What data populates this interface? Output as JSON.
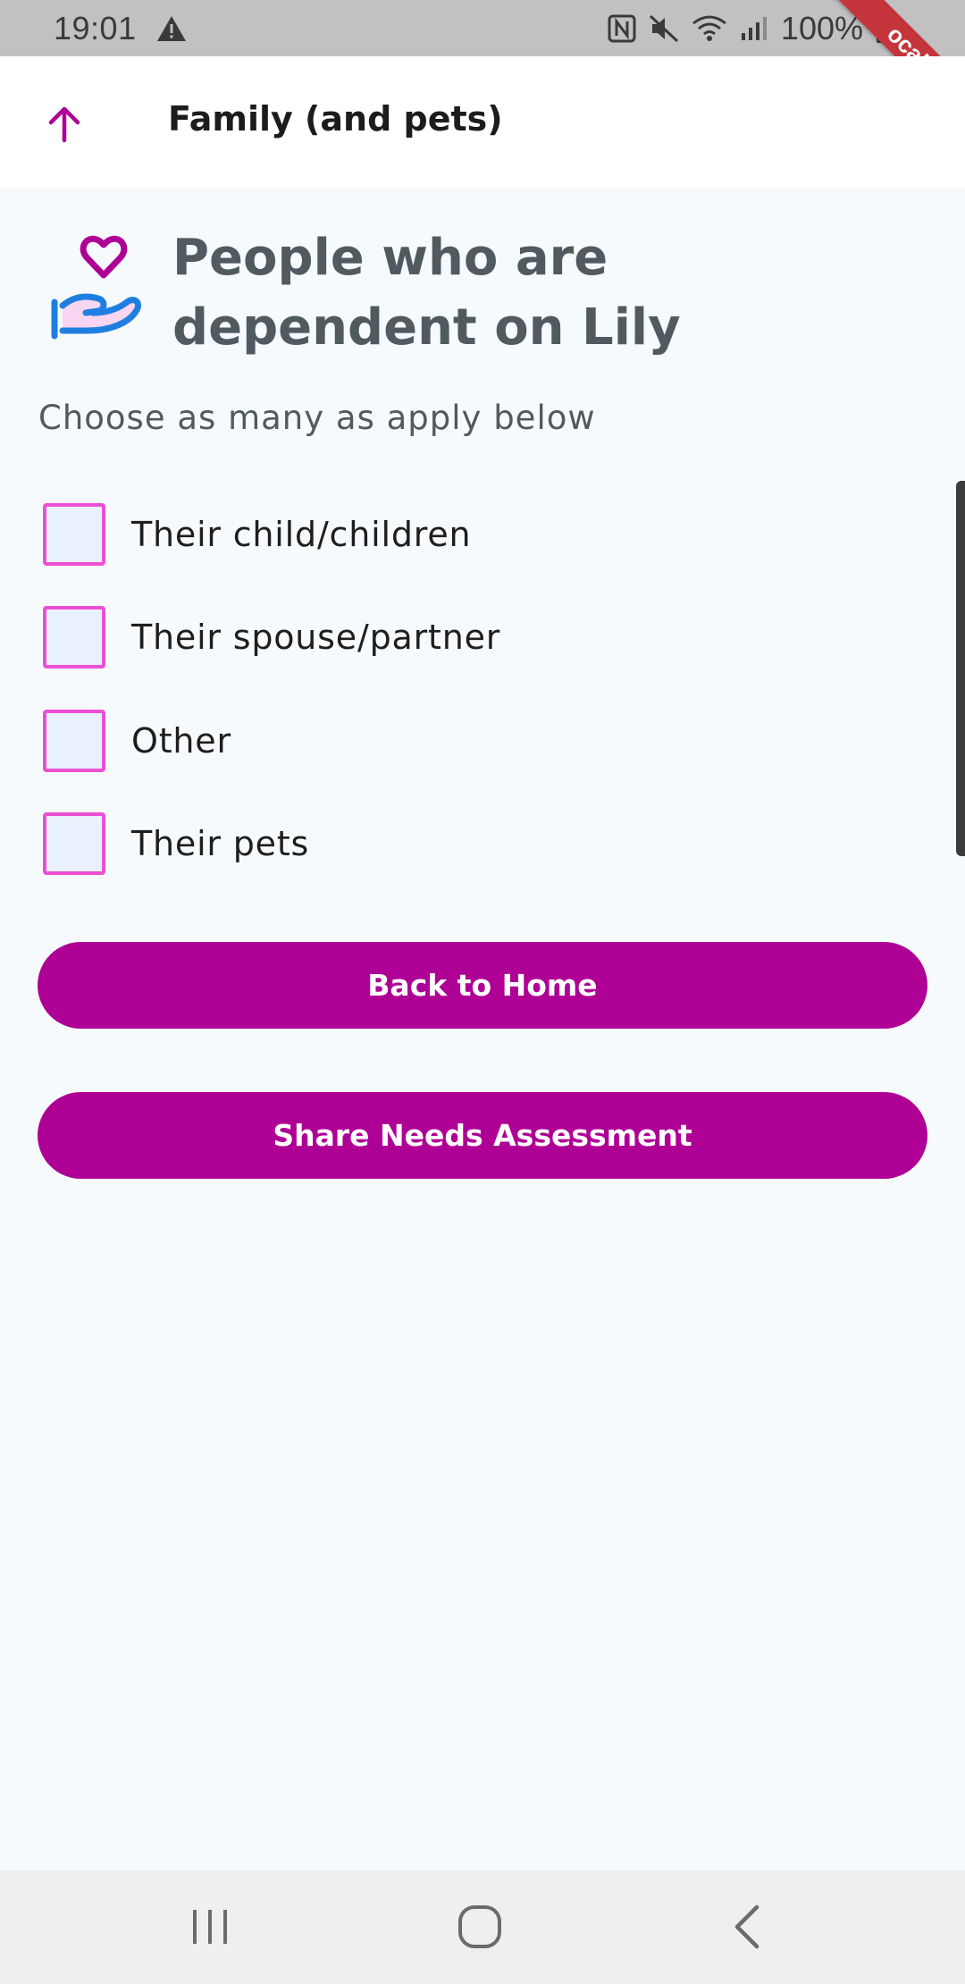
{
  "status_bar": {
    "time": "19:01",
    "battery": "100%",
    "icons": [
      "warning-icon",
      "nfc-icon",
      "mute-icon",
      "wifi-icon",
      "signal-icon",
      "battery-icon"
    ]
  },
  "debug_ribbon": "ocal",
  "app_bar": {
    "title": "Family (and pets)",
    "back_icon": "arrow-up-icon"
  },
  "heading": {
    "icon": "heart-in-hand-icon",
    "title": "People who are dependent on Lily"
  },
  "subtitle": "Choose as many as apply below",
  "options": [
    {
      "label": "Their child/children",
      "checked": false
    },
    {
      "label": "Their spouse/partner",
      "checked": false
    },
    {
      "label": "Other",
      "checked": false
    },
    {
      "label": "Their pets",
      "checked": false
    }
  ],
  "buttons": {
    "home": "Back to Home",
    "share": "Share Needs Assessment"
  },
  "colors": {
    "accent": "#af0096",
    "checkbox_border": "#ec4fd4",
    "checkbox_fill": "#e9f0fe",
    "heading_text": "#505a5f",
    "background": "#f7fafd"
  },
  "nav_bar": [
    "recents-icon",
    "home-icon",
    "back-icon"
  ]
}
